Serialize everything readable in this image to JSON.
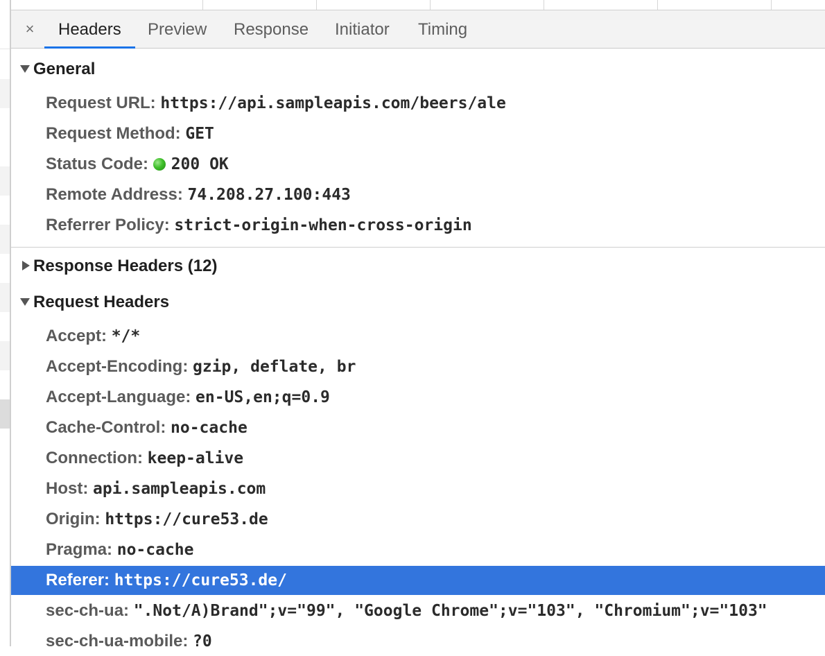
{
  "tabs": {
    "close_label": "×",
    "items": [
      "Headers",
      "Preview",
      "Response",
      "Initiator",
      "Timing"
    ],
    "active": "Headers"
  },
  "general": {
    "title": "General",
    "rows": [
      {
        "key": "Request URL:",
        "value": "https://api.sampleapis.com/beers/ale"
      },
      {
        "key": "Request Method:",
        "value": "GET"
      },
      {
        "key": "Status Code:",
        "value": "200 OK",
        "status_color": "#3fbf2a"
      },
      {
        "key": "Remote Address:",
        "value": "74.208.27.100:443"
      },
      {
        "key": "Referrer Policy:",
        "value": "strict-origin-when-cross-origin"
      }
    ]
  },
  "response_headers": {
    "title": "Response Headers (12)",
    "expanded": false
  },
  "request_headers": {
    "title": "Request Headers",
    "rows": [
      {
        "key": "Accept:",
        "value": "*/*"
      },
      {
        "key": "Accept-Encoding:",
        "value": "gzip, deflate, br"
      },
      {
        "key": "Accept-Language:",
        "value": "en-US,en;q=0.9"
      },
      {
        "key": "Cache-Control:",
        "value": "no-cache"
      },
      {
        "key": "Connection:",
        "value": "keep-alive"
      },
      {
        "key": "Host:",
        "value": "api.sampleapis.com"
      },
      {
        "key": "Origin:",
        "value": "https://cure53.de"
      },
      {
        "key": "Pragma:",
        "value": "no-cache"
      },
      {
        "key": "Referer:",
        "value": "https://cure53.de/",
        "selected": true
      },
      {
        "key": "sec-ch-ua:",
        "value": "\".Not/A)Brand\";v=\"99\", \"Google Chrome\";v=\"103\", \"Chromium\";v=\"103\""
      },
      {
        "key": "sec-ch-ua-mobile:",
        "value": "?0"
      }
    ]
  },
  "colors": {
    "selection": "#3375dd",
    "active_tab_underline": "#1a73e8"
  }
}
